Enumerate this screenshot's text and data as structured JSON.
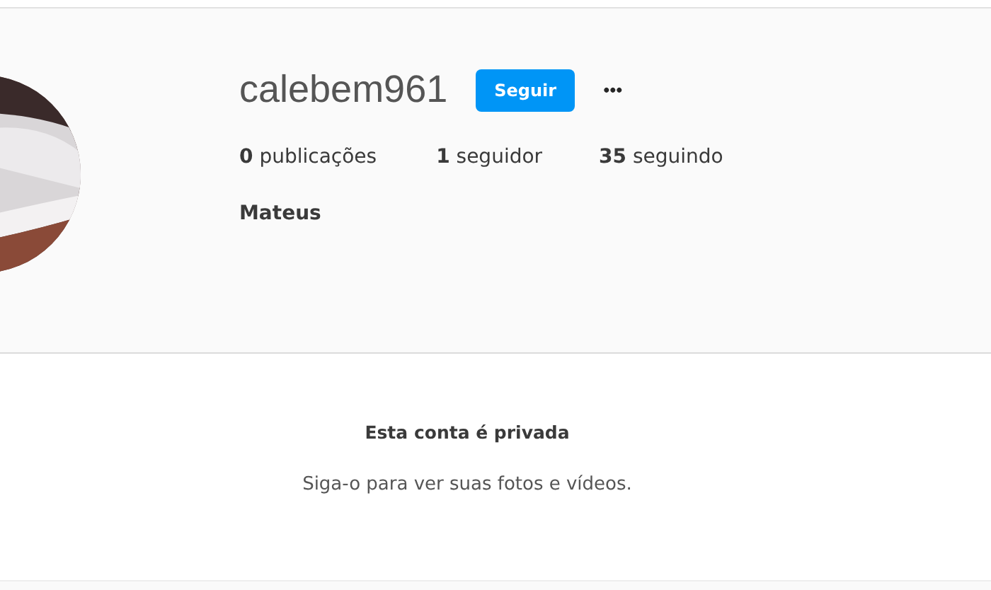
{
  "profile": {
    "username": "calebem961",
    "follow_button": "Seguir",
    "more": "•••",
    "stats": [
      "**0** publicações",
      "**1** seguidor",
      "**35** seguindo"
    ],
    "name": "Mateus"
  },
  "private": {
    "title": "Esta conta é privada",
    "subtitle": "Siga-o para ver suas fotos e vídeos."
  }
}
